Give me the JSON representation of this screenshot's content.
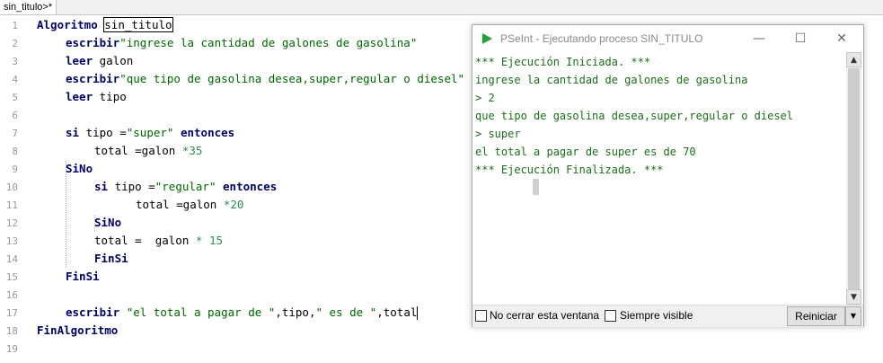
{
  "tab": {
    "label": "sin_titulo>*"
  },
  "editor": {
    "line_numbers": [
      "1",
      "2",
      "3",
      "4",
      "5",
      "6",
      "7",
      "8",
      "9",
      "10",
      "11",
      "12",
      "13",
      "14",
      "15",
      "16",
      "17",
      "18",
      "19"
    ],
    "l1": {
      "kw": "Algoritmo",
      "name": "sin_titulo"
    },
    "l2": {
      "kw": "escribir",
      "str": "\"ingrese la cantidad de galones de gasolina\""
    },
    "l3": {
      "kw": "leer",
      "rest": "galon"
    },
    "l4": {
      "kw": "escribir",
      "str": "\"que tipo de gasolina desea,super,regular o diesel\""
    },
    "l5": {
      "kw": "leer",
      "rest": "tipo"
    },
    "l7": {
      "kw": "si",
      "a": "tipo =",
      "str": "\"super\"",
      "kw2": "entonces"
    },
    "l8": {
      "a": "total =galon ",
      "num": "*35"
    },
    "l9": {
      "kw": "SiNo"
    },
    "l10": {
      "kw": "si",
      "a": "tipo =",
      "str": "\"regular\"",
      "kw2": "entonces"
    },
    "l11": {
      "a": "total =galon ",
      "num": "*20"
    },
    "l12": {
      "kw": "SiNo"
    },
    "l13": {
      "a": "total =  galon ",
      "num": "* 15"
    },
    "l14": {
      "kw": "FinSi"
    },
    "l15": {
      "kw": "FinSi"
    },
    "l17": {
      "kw": "escribir",
      "str1": "\"el total a pagar de \"",
      "a": ",tipo,",
      "str2": "\" es de \"",
      "b": ",total"
    },
    "l18": {
      "kw": "FinAlgoritmo"
    }
  },
  "run_window": {
    "title": "PSeInt - Ejecutando proceso SIN_TITULO",
    "minimize": "—",
    "maximize": "☐",
    "close": "✕",
    "console_lines": [
      "*** Ejecución Iniciada. ***",
      "ingrese la cantidad de galones de gasolina",
      "> 2",
      "que tipo de gasolina desea,super,regular o diesel",
      "> super",
      "el total a pagar de super es de 70",
      "*** Ejecución Finalizada. ***"
    ],
    "no_cerrar_label": "No cerrar esta ventana",
    "siempre_visible_label": "Siempre visible",
    "reiniciar_label": "Reiniciar",
    "scroll_up": "▲",
    "scroll_down": "▼",
    "drop_arrow": "▼"
  },
  "colors": {
    "keyword": "#000066",
    "string": "#006400",
    "console_text": "#1d6b1d",
    "play_icon": "#22a33a"
  }
}
